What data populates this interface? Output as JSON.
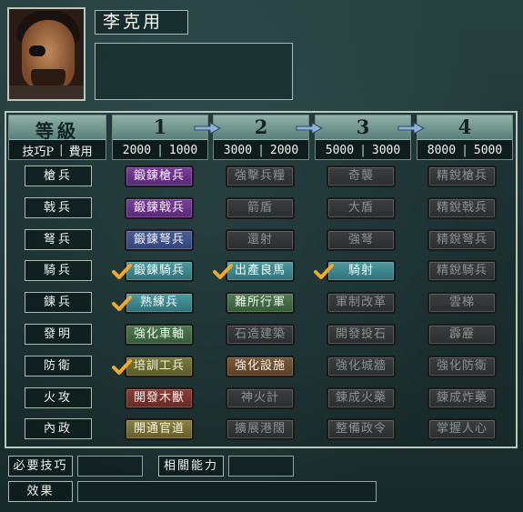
{
  "officer": {
    "name": "李克用"
  },
  "header": {
    "title": "等級",
    "subtitle_left": "技巧P",
    "subtitle_right": "費用",
    "levels": [
      {
        "num": "1",
        "tp": "2000",
        "cost": "1000"
      },
      {
        "num": "2",
        "tp": "3000",
        "cost": "2000"
      },
      {
        "num": "3",
        "tp": "5000",
        "cost": "3000"
      },
      {
        "num": "4",
        "tp": "8000",
        "cost": "5000"
      }
    ]
  },
  "rows": [
    {
      "label": "槍兵",
      "skills": [
        "鍛鍊槍兵",
        "強擊兵糧",
        "奇襲",
        "精銳槍兵"
      ]
    },
    {
      "label": "戟兵",
      "skills": [
        "鍛鍊戟兵",
        "箭盾",
        "大盾",
        "精銳戟兵"
      ]
    },
    {
      "label": "弩兵",
      "skills": [
        "鍛鍊弩兵",
        "還射",
        "強弩",
        "精銳弩兵"
      ]
    },
    {
      "label": "騎兵",
      "skills": [
        "鍛鍊騎兵",
        "出產良馬",
        "騎射",
        "精銳騎兵"
      ]
    },
    {
      "label": "鍊兵",
      "skills": [
        "熟練兵",
        "難所行軍",
        "軍制改革",
        "雲梯"
      ]
    },
    {
      "label": "發明",
      "skills": [
        "強化車軸",
        "石造建築",
        "開發投石",
        "霹靂"
      ]
    },
    {
      "label": "防衛",
      "skills": [
        "培訓工兵",
        "強化設施",
        "強化城牆",
        "強化防衛"
      ]
    },
    {
      "label": "火攻",
      "skills": [
        "開發木獸",
        "神火計",
        "錬成火藥",
        "錬成炸藥"
      ]
    },
    {
      "label": "內政",
      "skills": [
        "開通官道",
        "擴展港闊",
        "整備政令",
        "掌握人心"
      ]
    }
  ],
  "skill_colors": [
    [
      "purple",
      "gray",
      "gray",
      "gray"
    ],
    [
      "purple",
      "gray",
      "gray",
      "gray"
    ],
    [
      "blue",
      "gray",
      "gray",
      "gray"
    ],
    [
      "teal",
      "teal",
      "teal",
      "gray"
    ],
    [
      "teal",
      "green",
      "gray",
      "gray"
    ],
    [
      "green",
      "gray",
      "gray",
      "gray"
    ],
    [
      "olive",
      "brown",
      "gray",
      "gray"
    ],
    [
      "red",
      "gray",
      "gray",
      "gray"
    ],
    [
      "gold",
      "gray",
      "gray",
      "gray"
    ]
  ],
  "acquired": [
    [
      false,
      false,
      false,
      false
    ],
    [
      false,
      false,
      false,
      false
    ],
    [
      false,
      false,
      false,
      false
    ],
    [
      true,
      true,
      true,
      false
    ],
    [
      true,
      false,
      false,
      false
    ],
    [
      false,
      false,
      false,
      false
    ],
    [
      true,
      false,
      false,
      false
    ],
    [
      false,
      false,
      false,
      false
    ],
    [
      false,
      false,
      false,
      false
    ]
  ],
  "footer": {
    "required_label": "必要技巧",
    "related_label": "相關能力",
    "effect_label": "效果",
    "required_value": "",
    "related_value": "",
    "effect_value": ""
  },
  "colors": {
    "check": "#f0a830",
    "arrow": "#8fb0d8"
  }
}
